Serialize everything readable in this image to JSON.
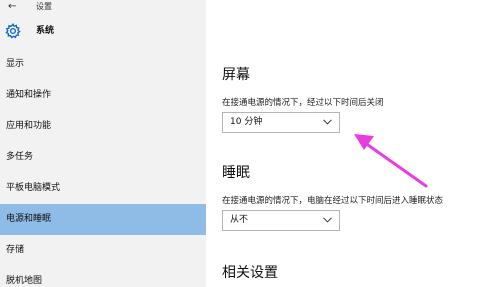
{
  "titlebar": {
    "back_icon": "back-arrow-icon",
    "title": "设置"
  },
  "header": {
    "icon": "gear-icon",
    "title": "系统"
  },
  "sidebar": {
    "items": [
      {
        "label": "显示"
      },
      {
        "label": "通知和操作"
      },
      {
        "label": "应用和功能"
      },
      {
        "label": "多任务"
      },
      {
        "label": "平板电脑模式"
      },
      {
        "label": "电源和睡眠",
        "active": true
      },
      {
        "label": "存储"
      },
      {
        "label": "脱机地图"
      }
    ]
  },
  "main": {
    "screen": {
      "title": "屏幕",
      "desc": "在接通电源的情况下，经过以下时间后关闭",
      "dropdown_value": "10 分钟"
    },
    "sleep": {
      "title": "睡眠",
      "desc": "在接通电源的情况下，电脑在经过以下时间后进入睡眠状态",
      "dropdown_value": "从不"
    },
    "related": {
      "title": "相关设置"
    }
  },
  "colors": {
    "sidebar_bg": "#f2f2f2",
    "active_bg": "#8fbce6",
    "accent": "#0a64c8",
    "annotation_arrow": "#e83ee0"
  }
}
